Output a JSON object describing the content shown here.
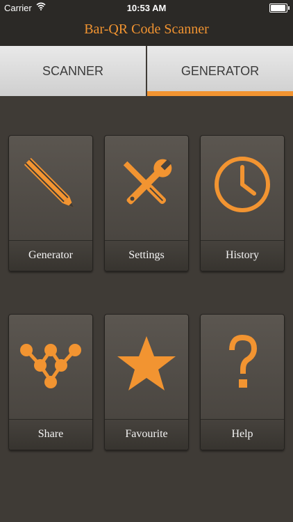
{
  "status": {
    "carrier": "Carrier",
    "time": "10:53 AM"
  },
  "header": {
    "title": "Bar-QR Code Scanner"
  },
  "tabs": [
    {
      "label": "SCANNER",
      "selected": false
    },
    {
      "label": "GENERATOR",
      "selected": true
    }
  ],
  "tiles": [
    {
      "label": "Generator",
      "icon": "pencil-icon"
    },
    {
      "label": "Settings",
      "icon": "wrench-screwdriver-icon"
    },
    {
      "label": "History",
      "icon": "clock-icon"
    },
    {
      "label": "Share",
      "icon": "share-network-icon"
    },
    {
      "label": "Favourite",
      "icon": "star-icon"
    },
    {
      "label": "Help",
      "icon": "question-mark-icon"
    }
  ],
  "colors": {
    "accent": "#f29431",
    "background": "#3f3b36",
    "header": "#2b2926"
  }
}
